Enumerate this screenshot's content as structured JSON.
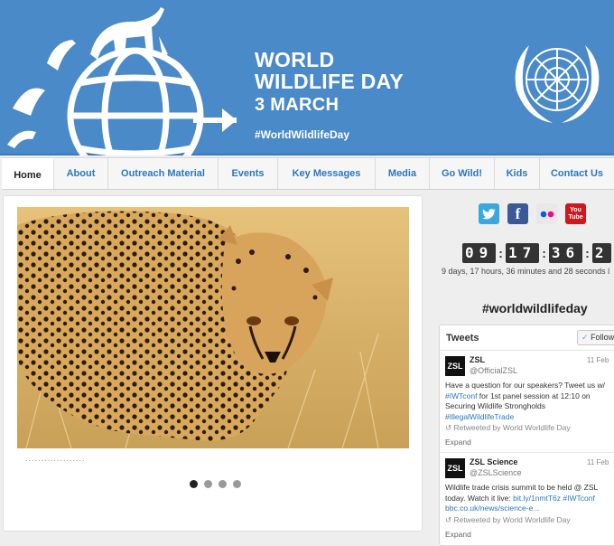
{
  "banner": {
    "title_line1": "WORLD",
    "title_line2": "WILDLIFE DAY",
    "date": "3 MARCH",
    "hashtag": "#WorldWildlifeDay",
    "color": "#4a8ac8"
  },
  "nav": {
    "items": [
      {
        "label": "Home",
        "active": true
      },
      {
        "label": "About"
      },
      {
        "label": "Outreach Material"
      },
      {
        "label": "Events"
      },
      {
        "label": "Key Messages"
      },
      {
        "label": "Media"
      },
      {
        "label": "Go Wild!"
      },
      {
        "label": "Kids"
      },
      {
        "label": "Contact Us"
      }
    ]
  },
  "slider": {
    "caption": "...................",
    "slide_count": 4,
    "active_slide": 1
  },
  "social": {
    "icons": [
      "twitter-icon",
      "facebook-icon",
      "flickr-icon",
      "youtube-icon"
    ],
    "youtube_label": "You Tube"
  },
  "countdown": {
    "hours": "09",
    "minutes": "17",
    "seconds": "36",
    "extra": "2",
    "text": "9 days, 17 hours, 36 minutes and 28 seconds l"
  },
  "sidebar": {
    "heading": "#worldwildlifeday"
  },
  "tweets": {
    "header": "Tweets",
    "follow": "Follow",
    "items": [
      {
        "avatar": "ZSL",
        "name": "ZSL",
        "handle": "@OfficialZSL",
        "date": "11 Feb",
        "text_before": "Have a question for our speakers? Tweet us w/ ",
        "link1": "#IWTconf",
        "text_mid": " for 1st panel session at 12:10 on Securing Wildlife Strongholds ",
        "link2": "#IllegalWildlifeTrade",
        "retweet": "Retweeted by World Worldlife Day",
        "expand": "Expand"
      },
      {
        "avatar": "ZSL",
        "name": "ZSL Science",
        "handle": "@ZSLScience",
        "date": "11 Feb",
        "text_before": "Wildlife trade crisis summit to be held @ ZSL today. Watch it live: ",
        "link1": "bit.ly/1nmtT6z",
        "text_mid": " ",
        "link2": "#IWTconf bbc.co.uk/news/science-e...",
        "retweet": "Retweeted by World Worldlife Day",
        "expand": "Expand"
      }
    ]
  }
}
